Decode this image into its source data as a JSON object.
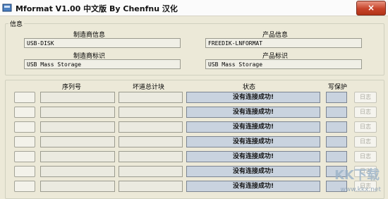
{
  "window": {
    "title": "Mformat V1.00 中文版 By Chenfnu 汉化",
    "close_glyph": "×"
  },
  "info": {
    "group_label": "信息",
    "manufacturer_info_label": "制造商信息",
    "manufacturer_info_value": "USB-DISK",
    "product_info_label": "产品信息",
    "product_info_value": "FREEDIK-LNFORMAT",
    "manufacturer_id_label": "制造商标识",
    "manufacturer_id_value": "USB Mass Storage",
    "product_id_label": "产品标识",
    "product_id_value": "USB Mass Storage"
  },
  "devices": {
    "headers": {
      "serial": "序列号",
      "bad_blocks": "坏道总计块",
      "status": "状态",
      "write_protect": "写保护"
    },
    "rows": [
      {
        "status": "没有连接成功!",
        "log": "日志"
      },
      {
        "status": "没有连接成功!",
        "log": "日志"
      },
      {
        "status": "没有连接成功!",
        "log": "日志"
      },
      {
        "status": "没有连接成功!",
        "log": "日志"
      },
      {
        "status": "没有连接成功!",
        "log": "日志"
      },
      {
        "status": "没有连接成功!",
        "log": "日志"
      },
      {
        "status": "没有连接成功!",
        "log": "日志"
      }
    ]
  },
  "watermark": {
    "text": "KK下载",
    "sub": "www.kkx.net"
  }
}
